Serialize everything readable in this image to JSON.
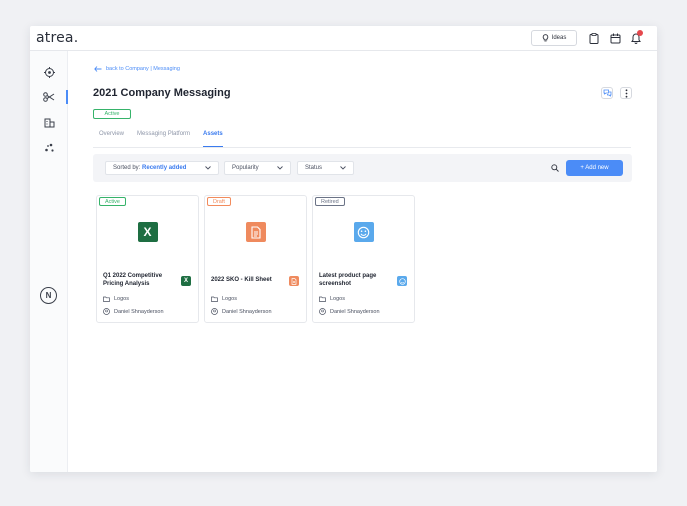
{
  "app": {
    "logo": "atrea."
  },
  "header": {
    "ideas_label": "Ideas"
  },
  "breadcrumb": {
    "back_label": "back to Company | Messaging"
  },
  "page": {
    "title": "2021 Company Messaging",
    "status": "Active"
  },
  "tabs": [
    {
      "label": "Overview"
    },
    {
      "label": "Messaging Platform"
    },
    {
      "label": "Assets",
      "active": true
    }
  ],
  "filters": {
    "sort_prefix": "Sorted by:",
    "sort_value": "Recently added",
    "popularity": "Popularity",
    "status": "Status",
    "add_new": "+ Add new"
  },
  "cards": [
    {
      "tag": "Active",
      "title": "Q1 2022 Competitive Pricing Analysis",
      "category": "Logos",
      "owner": "Daniel Shnayderson",
      "icon": "excel-icon"
    },
    {
      "tag": "Draft",
      "title": "2022 SKO - Kill Sheet",
      "category": "Logos",
      "owner": "Daniel Shnayderson",
      "icon": "document-icon"
    },
    {
      "tag": "Retired",
      "title": "Latest product page screenshot",
      "category": "Logos",
      "owner": "Daniel Shnayderson",
      "icon": "smiley-icon"
    }
  ],
  "colors": {
    "accent": "#4b8cf7",
    "active": "#36b36a",
    "draft": "#f28b5c",
    "retired": "#6b7386",
    "excel": "#1e6e42",
    "doc": "#ef8a5e",
    "image": "#5aa9ec",
    "notification": "#e5484d"
  }
}
